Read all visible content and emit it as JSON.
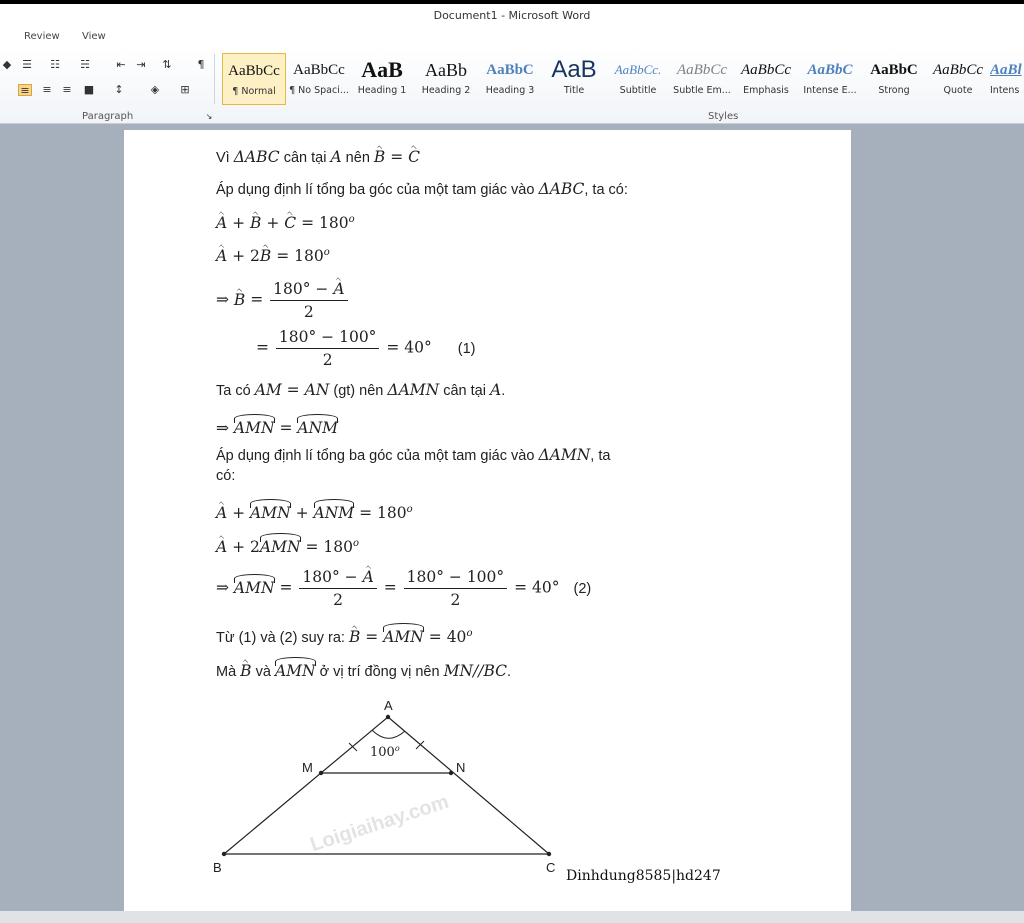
{
  "window": {
    "title": "Document1 - Microsoft Word"
  },
  "menu": {
    "items": [
      "Review",
      "View"
    ]
  },
  "ribbon": {
    "paragraph_label": "Paragraph",
    "styles_label": "Styles",
    "styles": [
      {
        "sample": "AaBbCc",
        "name": "¶ Normal",
        "selected": true
      },
      {
        "sample": "AaBbCc",
        "name": "¶ No Spaci..."
      },
      {
        "sample": "AaB",
        "name": "Heading 1"
      },
      {
        "sample": "AaBb",
        "name": "Heading 2"
      },
      {
        "sample": "AaBbC",
        "name": "Heading 3"
      },
      {
        "sample": "AaB",
        "name": "Title"
      },
      {
        "sample": "AaBbCc.",
        "name": "Subtitle"
      },
      {
        "sample": "AaBbCc",
        "name": "Subtle Em..."
      },
      {
        "sample": "AaBbCc",
        "name": "Emphasis"
      },
      {
        "sample": "AaBbC",
        "name": "Intense E..."
      },
      {
        "sample": "AaBbC",
        "name": "Strong"
      },
      {
        "sample": "AaBbCc",
        "name": "Quote"
      },
      {
        "sample": "AaBl",
        "name": "Intens"
      }
    ]
  },
  "doc": {
    "l1_a": "Vì ",
    "l1_b": "ΔABC",
    "l1_c": " cân tại ",
    "l1_d": "A",
    "l1_e": " nên ",
    "l2_a": "Áp dụng định lí tổng ba góc của một tam giác vào ",
    "l2_b": "ΔABC",
    "l2_c": ", ta có:",
    "eq_180o": "180",
    "eq_o": "o",
    "frac1_num": "180° − ",
    "frac1_den": "2",
    "frac2_num": "180° − 100°",
    "frac2_den": "2",
    "val_40": "40°",
    "tag1": "(1)",
    "l7_a": "Ta có ",
    "l7_b": "AM = AN",
    "l7_c": " (gt) nên ",
    "l7_d": "ΔAMN",
    "l7_e": " cân tại ",
    "l7_f": "A",
    "l7_g": ".",
    "l9_a": "Áp dụng định lí tổng ba góc của một tam giác vào ",
    "l9_b": "ΔAMN",
    "l9_c": ", ta",
    "l9_d": "có:",
    "tag2": "(2)",
    "l13_a": "Từ (1) và (2) suy ra: ",
    "l14_a": "Mà ",
    "l14_b": " và ",
    "l14_c": " ở vị trí đồng vị nên ",
    "l14_d": "MN//BC",
    "l14_e": "."
  },
  "figure": {
    "vertices": [
      "A",
      "M",
      "N",
      "B",
      "C"
    ],
    "angle_label": "100",
    "angle_sup": "o",
    "watermark": "Loigiaihay.com"
  },
  "credit": "Dinhdung8585|hd247"
}
